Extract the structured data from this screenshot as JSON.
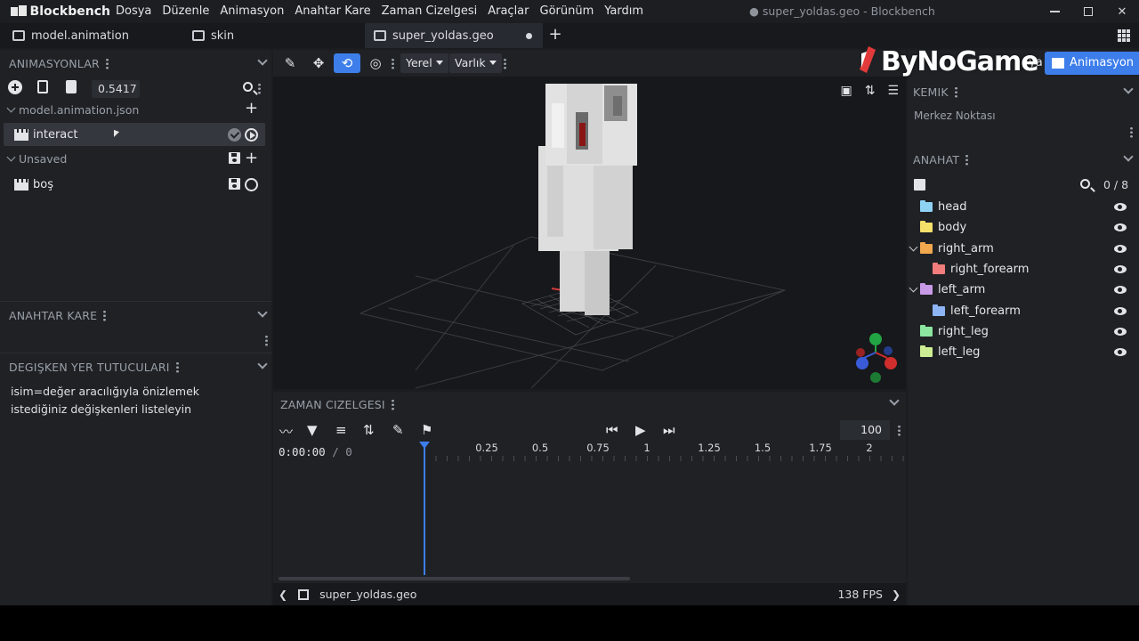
{
  "app": {
    "name": "Blockbench",
    "window_title": "● super_yoldas.geo - Blockbench"
  },
  "menu": [
    "Dosya",
    "Düzenle",
    "Animasyon",
    "Anahtar Kare",
    "Zaman Cizelgesi",
    "Araçlar",
    "Görünüm",
    "Yardım"
  ],
  "tabs": [
    {
      "label": "model.animation"
    },
    {
      "label": "skin"
    },
    {
      "label": "super_yoldas.geo"
    }
  ],
  "left": {
    "animations_header": "ANIMASYONLAR",
    "anim_length": "0.5417",
    "groups": [
      {
        "label": "model.animation.json",
        "items": [
          {
            "label": "interact"
          }
        ]
      },
      {
        "label": "Unsaved",
        "items": [
          {
            "label": "boş"
          }
        ]
      }
    ],
    "keyframe_header": "ANAHTAR KARE",
    "variable_header": "DEGIŞKEN YER TUTUCULARI",
    "variable_text": "isim=değer aracılığıyla önizlemek istediğiniz değişkenleri listeleyin"
  },
  "toolbar": {
    "space_dropdown": "Yerel",
    "entity_dropdown": "Varlık"
  },
  "right": {
    "mode_partial": "ya",
    "mode_active": "Animasyon",
    "bone_header": "KEMIK",
    "pivot_label": "Merkez Noktası",
    "outliner_header": "ANAHAT",
    "outliner_count": "0 / 8",
    "nodes": [
      {
        "label": "head",
        "color": "#8fd3f4",
        "level": 0,
        "expandable": false
      },
      {
        "label": "body",
        "color": "#f5e06a",
        "level": 0,
        "expandable": false
      },
      {
        "label": "right_arm",
        "color": "#f0a74e",
        "level": 0,
        "expandable": true
      },
      {
        "label": "right_forearm",
        "color": "#f07c7c",
        "level": 1,
        "expandable": false
      },
      {
        "label": "left_arm",
        "color": "#c99ae6",
        "level": 0,
        "expandable": true
      },
      {
        "label": "left_forearm",
        "color": "#8fb4f4",
        "level": 1,
        "expandable": false
      },
      {
        "label": "right_leg",
        "color": "#8ce6a0",
        "level": 0,
        "expandable": false
      },
      {
        "label": "left_leg",
        "color": "#cdee92",
        "level": 0,
        "expandable": false
      }
    ]
  },
  "watermark": "ByNoGame",
  "timeline": {
    "header": "ZAMAN CIZELGESI",
    "time": "0:00:00",
    "frame": "0",
    "zoom": "100",
    "ruler": [
      "0.25",
      "0.5",
      "0.75",
      "1",
      "1.25",
      "1.5",
      "1.75",
      "2"
    ],
    "file": "super_yoldas.geo",
    "fps": "138 FPS"
  }
}
